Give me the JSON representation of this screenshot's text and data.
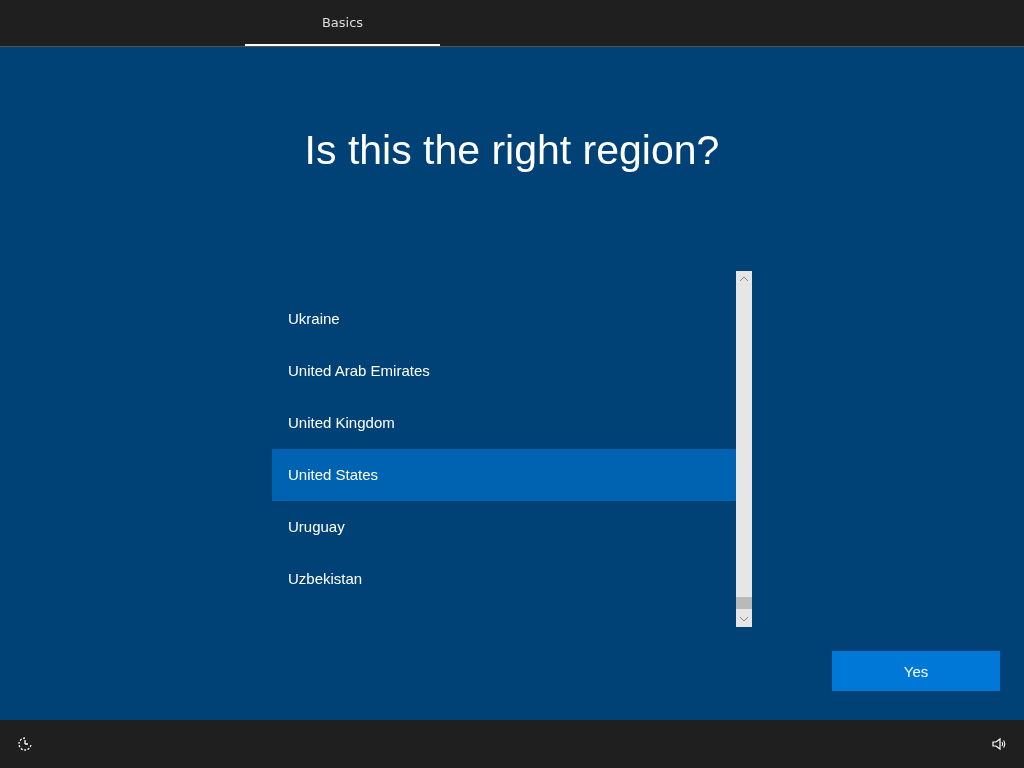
{
  "tabs": [
    {
      "label": "Basics",
      "selected": true
    }
  ],
  "title": "Is this the right region?",
  "regions": [
    {
      "name": "Ukraine",
      "selected": false
    },
    {
      "name": "United Arab Emirates",
      "selected": false
    },
    {
      "name": "United Kingdom",
      "selected": false
    },
    {
      "name": "United States",
      "selected": true
    },
    {
      "name": "Uruguay",
      "selected": false
    },
    {
      "name": "Uzbekistan",
      "selected": false
    }
  ],
  "buttons": [
    "Yes"
  ]
}
